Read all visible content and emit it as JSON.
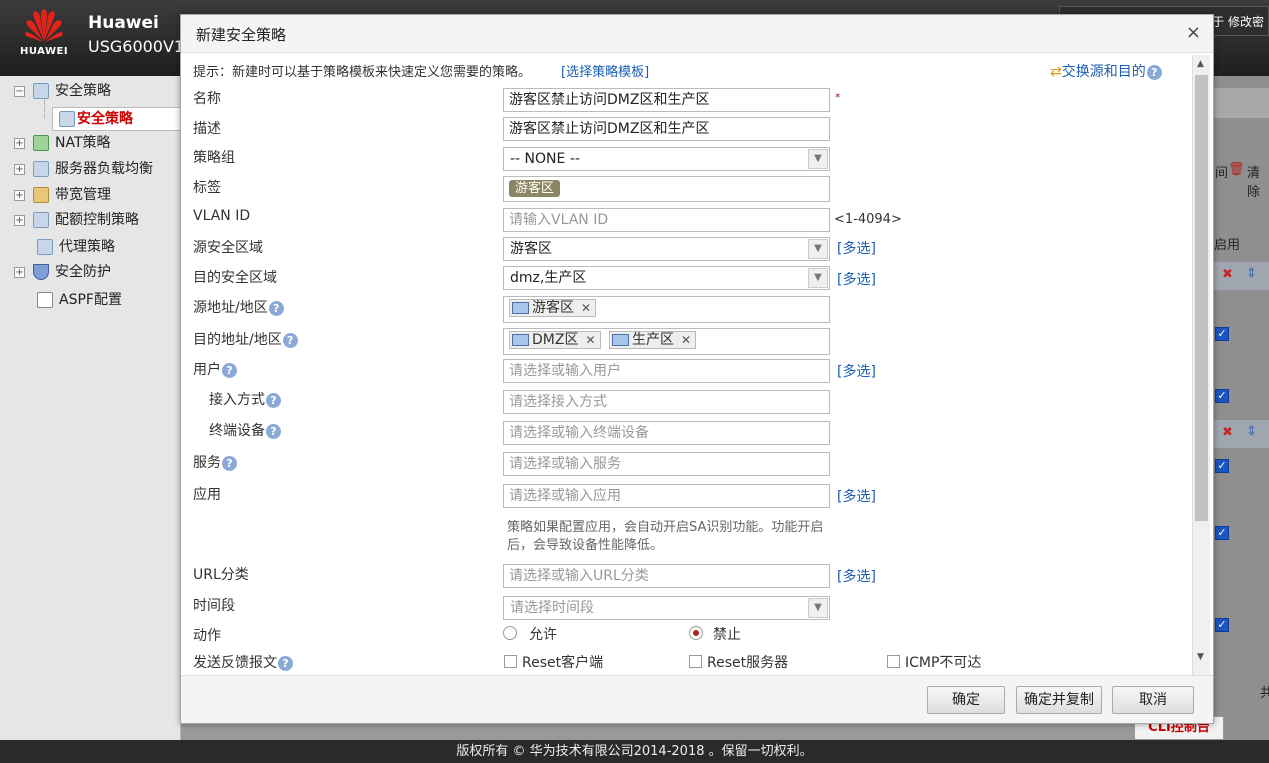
{
  "header": {
    "brand": "Huawei",
    "model": "USG6000V1",
    "logo_text": "HUAWEI",
    "right_text": "于 修改密"
  },
  "sidebar": {
    "items": [
      {
        "label": "安全策略",
        "expander": "−",
        "icon": "policy-icon"
      },
      {
        "label": "安全策略",
        "expander": "",
        "icon": "policy-icon",
        "selected": true
      },
      {
        "label": "NAT策略",
        "expander": "+",
        "icon": "nat-icon"
      },
      {
        "label": "服务器负载均衡",
        "expander": "+",
        "icon": "server-icon"
      },
      {
        "label": "带宽管理",
        "expander": "+",
        "icon": "bandwidth-icon"
      },
      {
        "label": "配额控制策略",
        "expander": "+",
        "icon": "quota-icon"
      },
      {
        "label": "代理策略",
        "expander": "",
        "icon": "proxy-icon"
      },
      {
        "label": "安全防护",
        "expander": "+",
        "icon": "shield-icon"
      },
      {
        "label": "ASPF配置",
        "expander": "",
        "icon": "aspf-icon"
      }
    ]
  },
  "background": {
    "delete_text": "清除",
    "col_text": "启用",
    "btm_text": "共",
    "cli_text": "CLI控制台",
    "frag_text": "间"
  },
  "dialog": {
    "title": "新建安全策略",
    "close": "×",
    "hint": "提示：新建时可以基于策略模板来快速定义您需要的策略。",
    "template_link": "[选择策略模板]",
    "swap_link": "交换源和目的",
    "required_mark": "*",
    "multi_select": "[多选]",
    "vlan_range": "<1-4094>",
    "fields": {
      "name": {
        "label": "名称",
        "value": "游客区禁止访问DMZ区和生产区"
      },
      "desc": {
        "label": "描述",
        "value": "游客区禁止访问DMZ区和生产区"
      },
      "group": {
        "label": "策略组",
        "value": "-- NONE --"
      },
      "tag": {
        "label": "标签",
        "value": "游客区"
      },
      "vlan": {
        "label": "VLAN ID",
        "placeholder": "请输入VLAN ID"
      },
      "src_zone": {
        "label": "源安全区域",
        "value": "游客区"
      },
      "dst_zone": {
        "label": "目的安全区域",
        "value": "dmz,生产区"
      },
      "src_addr": {
        "label": "源地址/地区",
        "tags": [
          "游客区"
        ]
      },
      "dst_addr": {
        "label": "目的地址/地区",
        "tags": [
          "DMZ区",
          "生产区"
        ]
      },
      "user": {
        "label": "用户",
        "placeholder": "请选择或输入用户"
      },
      "access": {
        "label": "接入方式",
        "placeholder": "请选择接入方式"
      },
      "device": {
        "label": "终端设备",
        "placeholder": "请选择或输入终端设备"
      },
      "service": {
        "label": "服务",
        "placeholder": "请选择或输入服务"
      },
      "app": {
        "label": "应用",
        "placeholder": "请选择或输入应用",
        "note": "策略如果配置应用，会自动开启SA识别功能。功能开启后，会导致设备性能降低。"
      },
      "url": {
        "label": "URL分类",
        "placeholder": "请选择或输入URL分类"
      },
      "time": {
        "label": "时间段",
        "placeholder": "请选择时间段"
      },
      "action": {
        "label": "动作",
        "permit": "允许",
        "deny": "禁止"
      },
      "feedback": {
        "label": "发送反馈报文",
        "opt1": "Reset客户端",
        "opt2": "Reset服务器",
        "opt3": "ICMP不可达"
      }
    },
    "buttons": {
      "ok": "确定",
      "ok_copy": "确定并复制",
      "cancel": "取消"
    }
  },
  "footer": {
    "text": "版权所有 © 华为技术有限公司2014-2018 。保留一切权利。"
  }
}
